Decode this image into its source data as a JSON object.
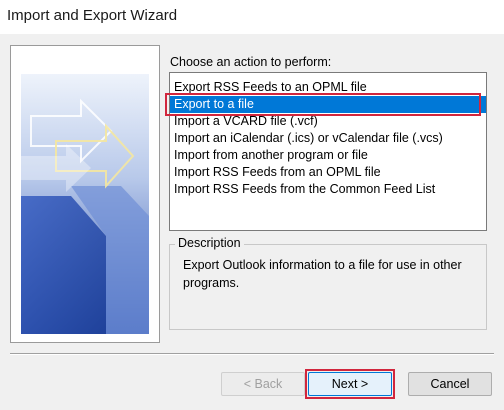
{
  "window": {
    "title": "Import and Export Wizard"
  },
  "prompt": "Choose an action to perform:",
  "actions": [
    {
      "label": "Export RSS Feeds to an OPML file",
      "selected": false
    },
    {
      "label": "Export to a file",
      "selected": true
    },
    {
      "label": "Import a VCARD file (.vcf)",
      "selected": false
    },
    {
      "label": "Import an iCalendar (.ics) or vCalendar file (.vcs)",
      "selected": false
    },
    {
      "label": "Import from another program or file",
      "selected": false
    },
    {
      "label": "Import RSS Feeds from an OPML file",
      "selected": false
    },
    {
      "label": "Import RSS Feeds from the Common Feed List",
      "selected": false
    }
  ],
  "description": {
    "legend": "Description",
    "text": "Export Outlook information to a file for use in other programs."
  },
  "buttons": {
    "back": "< Back",
    "next": "Next >",
    "cancel": "Cancel"
  },
  "colors": {
    "selection": "#0078d7",
    "highlight": "#d1263d"
  }
}
